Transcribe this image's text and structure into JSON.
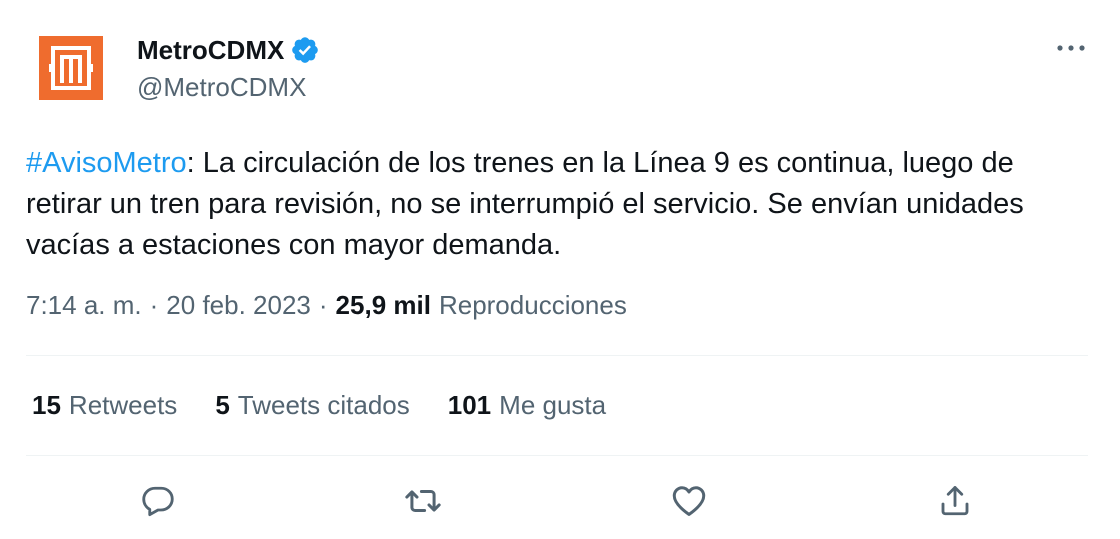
{
  "author": {
    "display_name": "MetroCDMX",
    "handle": "@MetroCDMX",
    "verified": true,
    "avatar_icon": "metro-logo-icon",
    "avatar_color": "#ef6c2e"
  },
  "tweet": {
    "hashtag": "#AvisoMetro",
    "text": ": La circulación de los trenes en la Línea 9 es continua, luego de retirar un tren para revisión, no se interrumpió el servicio. Se envían unidades vacías a estaciones con mayor demanda."
  },
  "meta": {
    "time": "7:14 a. m.",
    "separator": "·",
    "date": "20 feb. 2023",
    "views_count": "25,9 mil",
    "views_label": "Reproducciones"
  },
  "stats": {
    "retweets_count": "15",
    "retweets_label": "Retweets",
    "quotes_count": "5",
    "quotes_label": "Tweets citados",
    "likes_count": "101",
    "likes_label": "Me gusta"
  },
  "colors": {
    "link": "#1d9bf0",
    "verified": "#1d9bf0",
    "secondary_text": "#536471",
    "primary_text": "#0f1419"
  },
  "actions": {
    "reply_icon": "reply-icon",
    "retweet_icon": "retweet-icon",
    "like_icon": "heart-icon",
    "share_icon": "share-icon",
    "more_icon": "more-icon"
  }
}
